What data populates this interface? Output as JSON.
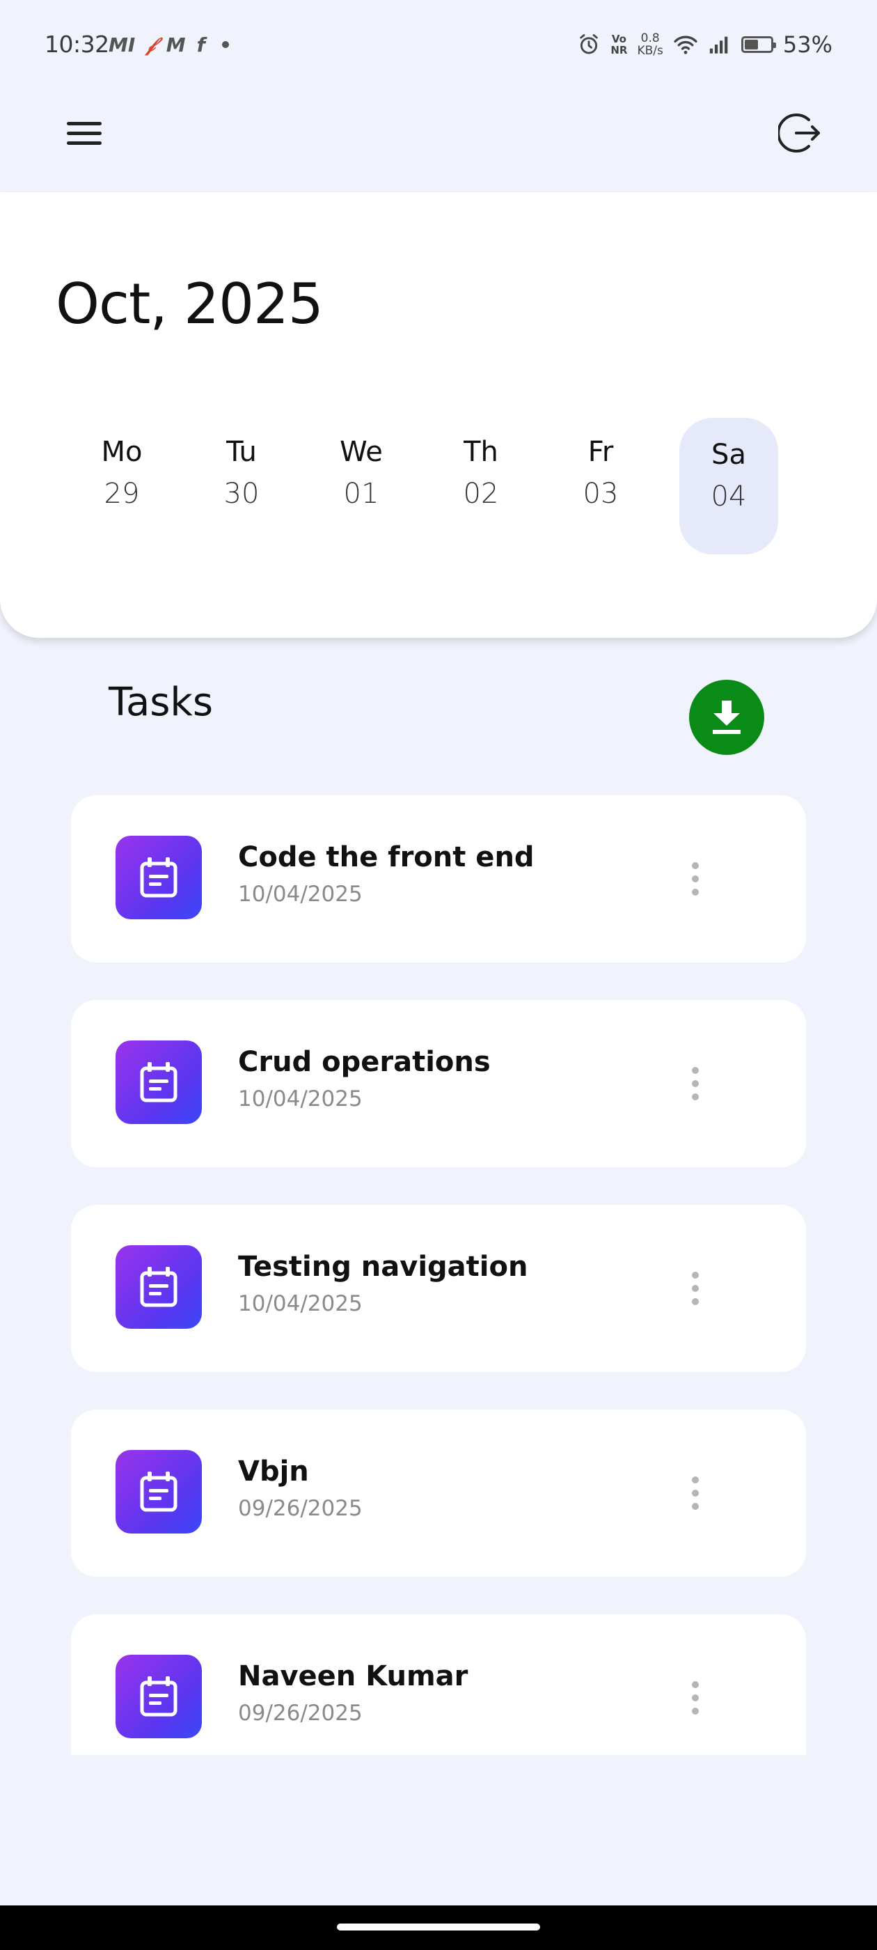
{
  "status_bar": {
    "time": "10:32",
    "app_icons": [
      "MI",
      "𝒻",
      "M",
      "f"
    ],
    "volte_top": "Vo",
    "volte_bottom": "NR",
    "speed_value": "0.8",
    "speed_unit": "KB/s",
    "battery_percent": "53%",
    "battery_level": 0.53
  },
  "app_bar": {
    "menu_icon": "hamburger-menu-icon",
    "logout_icon": "logout-icon"
  },
  "calendar": {
    "month_title": "Oct, 2025",
    "days": [
      {
        "name": "Mo",
        "num": "29",
        "selected": false
      },
      {
        "name": "Tu",
        "num": "30",
        "selected": false
      },
      {
        "name": "We",
        "num": "01",
        "selected": false
      },
      {
        "name": "Th",
        "num": "02",
        "selected": false
      },
      {
        "name": "Fr",
        "num": "03",
        "selected": false
      },
      {
        "name": "Sa",
        "num": "04",
        "selected": true
      }
    ],
    "selected_bg": "#e6e9fa"
  },
  "tasks": {
    "title": "Tasks",
    "download_icon": "download-icon",
    "download_color": "#0a8a16",
    "items": [
      {
        "title": "Code the front end",
        "date": "10/04/2025"
      },
      {
        "title": "Crud operations",
        "date": "10/04/2025"
      },
      {
        "title": "Testing navigation",
        "date": "10/04/2025"
      },
      {
        "title": "Vbjn",
        "date": "09/26/2025"
      },
      {
        "title": "Naveen Kumar",
        "date": "09/26/2025"
      }
    ],
    "item_icon": "calendar-note-icon",
    "icon_gradient": [
      "#9b33ec",
      "#3a47f7"
    ]
  }
}
